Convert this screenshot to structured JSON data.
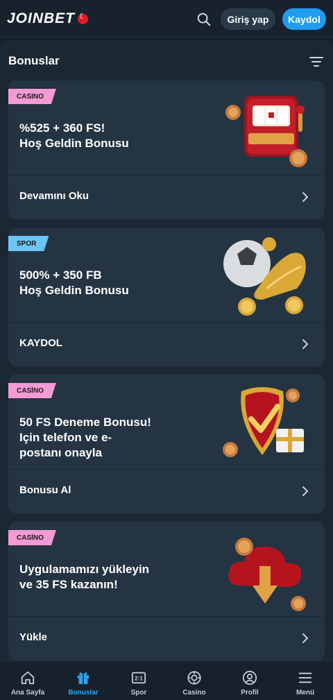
{
  "header": {
    "logo_text": "JOINBET",
    "login_label": "Giriş yap",
    "register_label": "Kaydol"
  },
  "panel": {
    "title": "Bonuslar"
  },
  "cards": [
    {
      "tag": "CASINO",
      "title": "%525 + 360 FS!\nHoş Geldin Bonusu",
      "link": "Devamını Oku",
      "art": "slot-machine-icon"
    },
    {
      "tag": "SPOR",
      "title": "500% + 350 FB\nHoş Geldin Bonusu",
      "link": "KAYDOL",
      "art": "football-boot-icon"
    },
    {
      "tag": "CASİNO",
      "title": "50 FS Deneme Bonusu!\nIçin telefon ve e-\npostanı onayla",
      "link": "Bonusu Al",
      "art": "shield-check-icon"
    },
    {
      "tag": "CASİNO",
      "title": "Uygulamamızı yükleyin\nve 35 FS kazanın!",
      "link": "Yükle",
      "art": "cloud-download-icon"
    }
  ],
  "nav": [
    {
      "label": "Ana Sayfa",
      "icon": "home-icon"
    },
    {
      "label": "Bonuslar",
      "icon": "gift-icon",
      "active": true
    },
    {
      "label": "Spor",
      "icon": "scoreboard-icon"
    },
    {
      "label": "Casino",
      "icon": "chip-icon"
    },
    {
      "label": "Profil",
      "icon": "user-icon"
    },
    {
      "label": "Menü",
      "icon": "menu-icon"
    }
  ],
  "colors": {
    "accent": "#1e9cf0",
    "casino_tag": "#f29ad3",
    "spor_tag": "#6cc4f5"
  }
}
